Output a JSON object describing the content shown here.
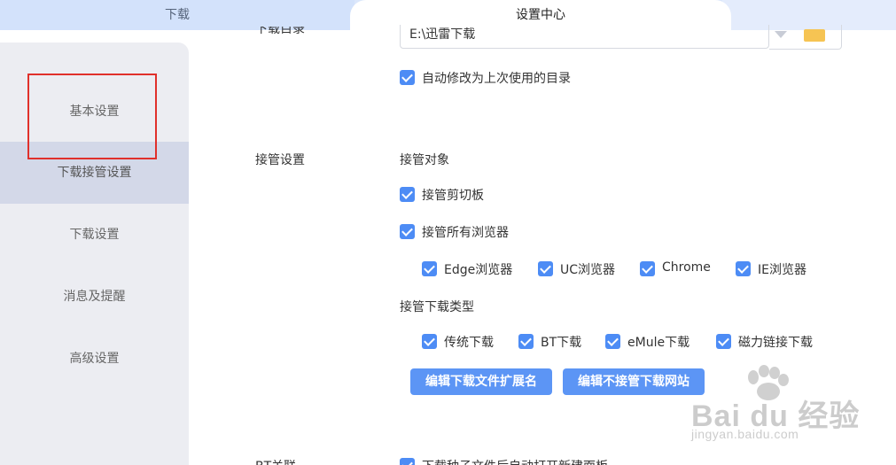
{
  "tabs": {
    "left": "下载",
    "active": "设置中心"
  },
  "sidebar": {
    "items": [
      {
        "label": "基本设置"
      },
      {
        "label": "下载接管设置"
      },
      {
        "label": "下载设置"
      },
      {
        "label": "消息及提醒"
      },
      {
        "label": "高级设置"
      }
    ],
    "active_index": 1
  },
  "download_dir": {
    "label": "下载目录",
    "value": "E:\\迅雷下载",
    "auto_change_label": "自动修改为上次使用的目录",
    "auto_change_checked": true
  },
  "takeover": {
    "section_label": "接管设置",
    "target_heading": "接管对象",
    "clipboard_label": "接管剪切板",
    "all_browsers_label": "接管所有浏览器",
    "browsers": [
      {
        "label": "Edge浏览器",
        "checked": true
      },
      {
        "label": "UC浏览器",
        "checked": true
      },
      {
        "label": "Chrome",
        "checked": true
      },
      {
        "label": "IE浏览器",
        "checked": true
      }
    ],
    "type_heading": "接管下载类型",
    "types": [
      {
        "label": "传统下载",
        "checked": true
      },
      {
        "label": "BT下载",
        "checked": true
      },
      {
        "label": "eMule下载",
        "checked": true
      },
      {
        "label": "磁力链接下载",
        "checked": true
      }
    ],
    "edit_ext_button": "编辑下载文件扩展名",
    "edit_sites_button": "编辑不接管下载网站"
  },
  "bt": {
    "section_label": "BT关联",
    "auto_open_label": "下载种子文件后自动打开新建面板"
  },
  "watermark": {
    "main": "Bai du 经验",
    "sub": "jingyan.baidu.com"
  },
  "colors": {
    "accent": "#4d8cf5",
    "button": "#5c95f5",
    "sidebar_bg": "#ecedf2",
    "sidebar_active": "#d3d8e8",
    "highlight_box": "#e0302b"
  }
}
